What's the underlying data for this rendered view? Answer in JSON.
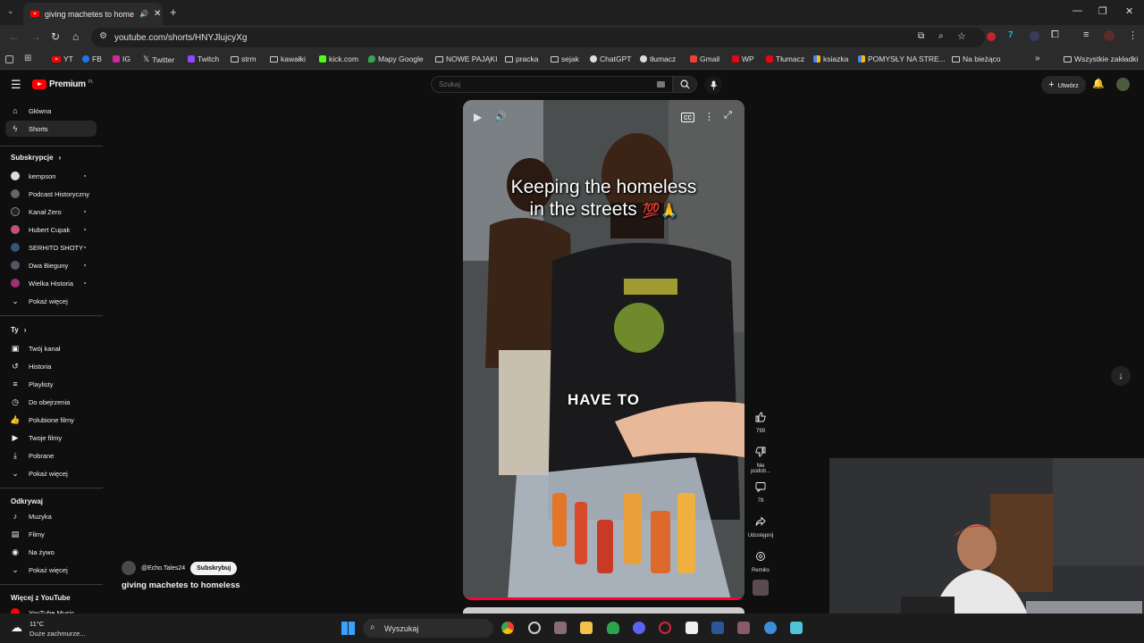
{
  "browser": {
    "tab_title": "giving machetes to homele",
    "url": "youtube.com/shorts/HNYJlujcyXg",
    "bookmarks": [
      "YT",
      "FB",
      "IG",
      "Twitter",
      "Twitch",
      "strm",
      "kawałki",
      "kick.com",
      "Mapy Google",
      "NOWE PAJĄKI",
      "pracka",
      "sejak",
      "ChatGPT",
      "tłumacz",
      "Gmail",
      "WP",
      "Tłumacz",
      "ksiazka",
      "POMYSŁY NA STRE...",
      "Na bieżąco"
    ],
    "all_bookmarks": "Wszystkie zakładki"
  },
  "youtube": {
    "logo": "Premium",
    "logo_sup": "PL",
    "search_placeholder": "Szukaj",
    "create_label": "Utwórz",
    "nav": {
      "home": "Główna",
      "shorts": "Shorts"
    },
    "subs_title": "Subskrypcje",
    "subscriptions": [
      "kempson",
      "Podcast Historyczny",
      "Kanał Zero",
      "Hubert Cupak",
      "SERHITO SHOTY",
      "Dwa Bieguny",
      "Wielka Historia"
    ],
    "show_more": "Pokaż więcej",
    "you_title": "Ty",
    "you_items": [
      "Twój kanał",
      "Historia",
      "Playlisty",
      "Do obejrzenia",
      "Polubione filmy",
      "Twoje filmy",
      "Pobrane",
      "Pokaż więcej"
    ],
    "explore_title": "Odkrywaj",
    "explore_items": [
      "Muzyka",
      "Filmy",
      "Na żywo",
      "Pokaż więcej"
    ],
    "more_title": "Więcej z YouTube",
    "more_item": "YouTube Music"
  },
  "short": {
    "caption_line1": "Keeping the homeless",
    "caption_line2": "in the streets",
    "overlay_text": "HAVE TO",
    "channel": "@Echo.Tales24",
    "subscribe_label": "Subskrybuj",
    "title": "giving machetes to homeless",
    "likes": "799",
    "dislike_label": "Nie podob...",
    "comments": "78",
    "share_label": "Udostępnij",
    "remix_label": "Remiks",
    "progress": 0.99
  },
  "taskbar": {
    "weather_temp": "11°C",
    "weather_desc": "Duże zachmurze...",
    "search_label": "Wyszukaj"
  },
  "colors": {
    "yt_red": "#ff0000",
    "bg": "#0f0f0f"
  }
}
